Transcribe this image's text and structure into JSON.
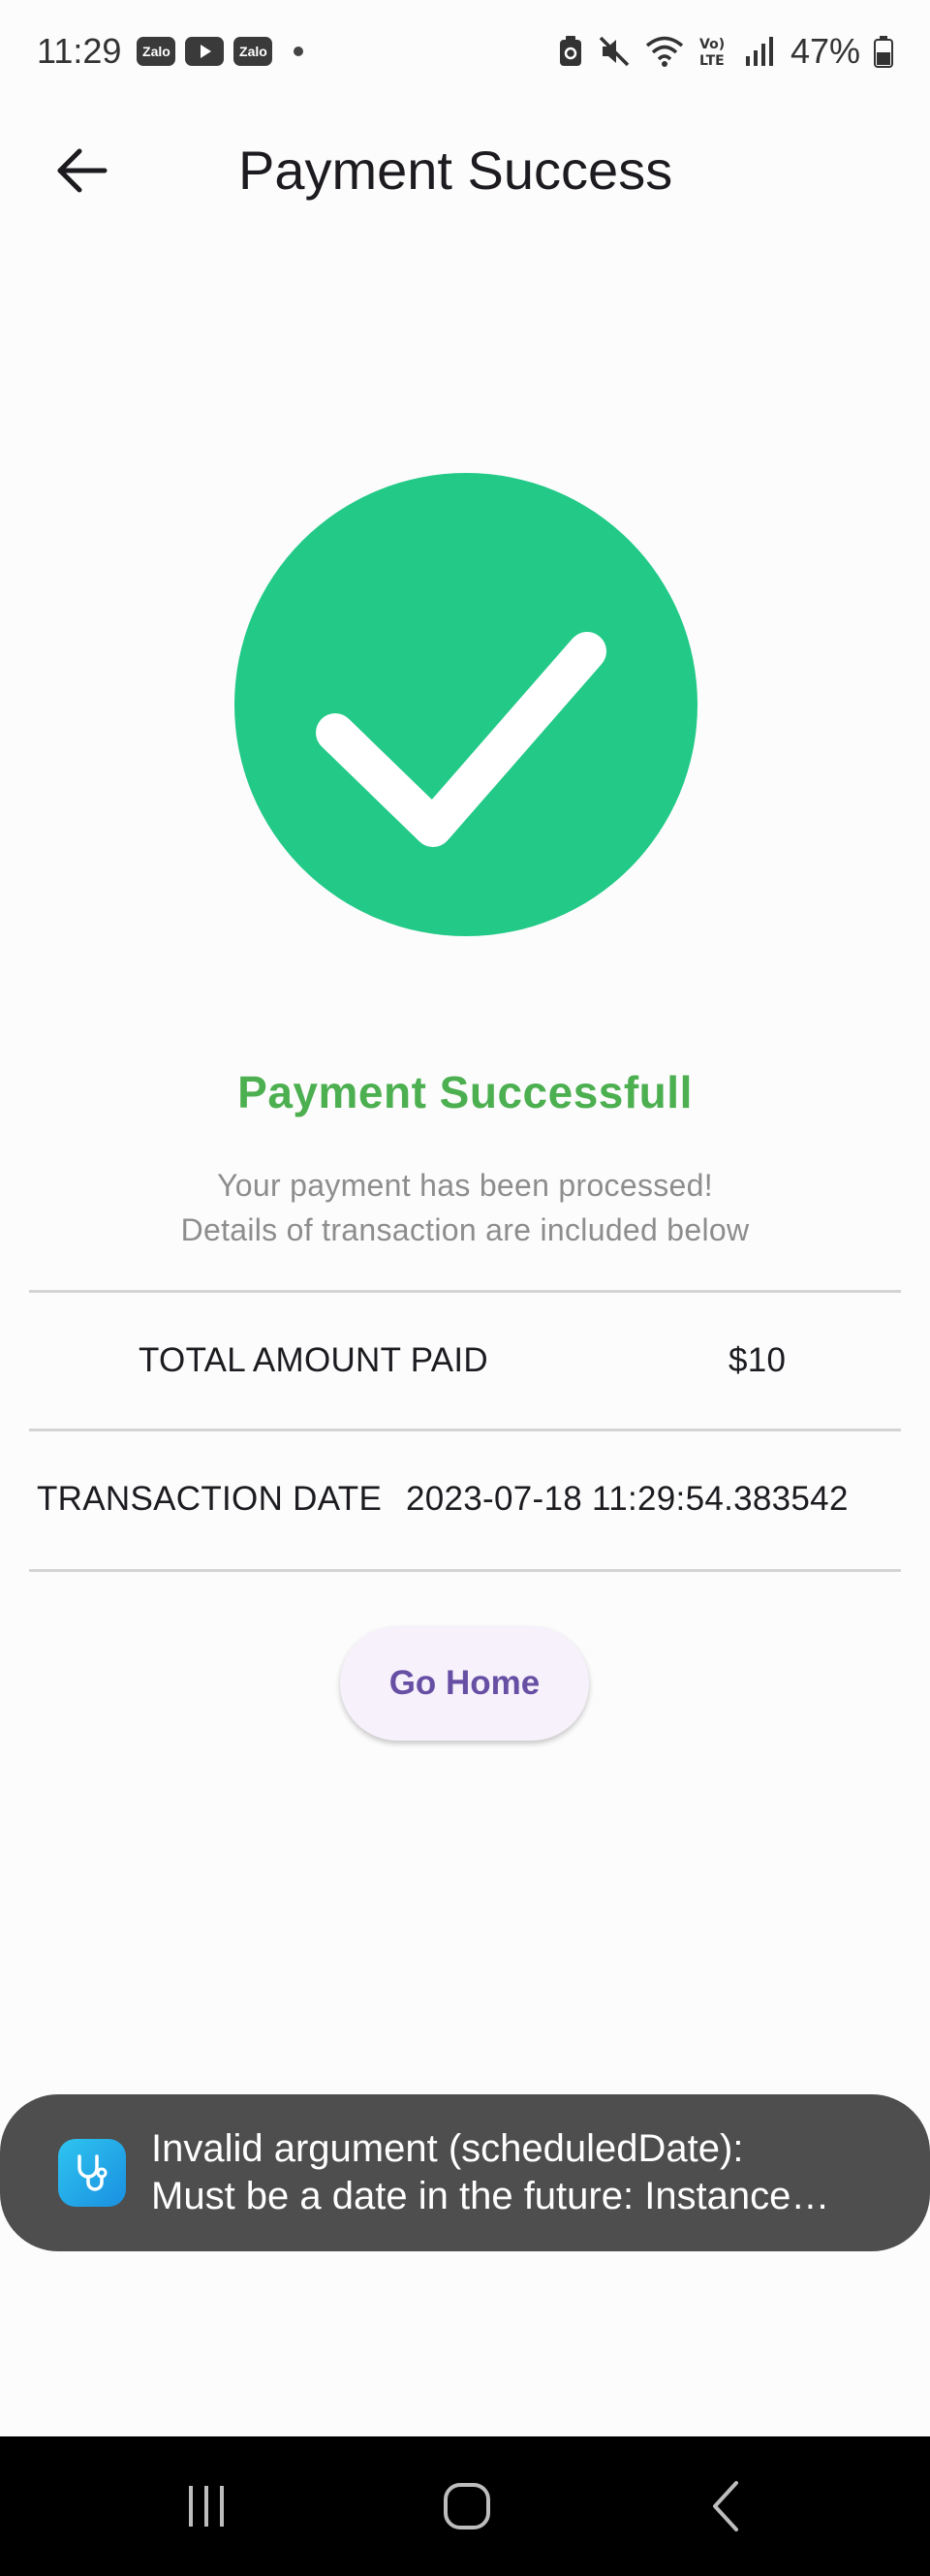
{
  "status_bar": {
    "time": "11:29",
    "notifications": [
      "Zalo",
      "YouTube",
      "Zalo"
    ],
    "signal_label": "Vo) LTE",
    "battery_percent": "47%"
  },
  "app_bar": {
    "title": "Payment Success",
    "back_icon": "arrow-left-icon"
  },
  "success": {
    "icon": "check-circle-icon",
    "icon_color": "#22c987",
    "heading": "Payment Successfull",
    "heading_color": "#4caf50",
    "line1": "Your payment has been processed!",
    "line2": "Details of transaction are included below"
  },
  "details": {
    "amount_label": "TOTAL AMOUNT PAID",
    "amount_value": "$10",
    "date_label": "TRANSACTION DATE",
    "date_value": "2023-07-18 11:29:54.383542"
  },
  "actions": {
    "go_home_label": "Go Home",
    "accent_color": "#6750a4"
  },
  "toast": {
    "app_icon": "stethoscope-icon",
    "line1": "Invalid argument (scheduledDate):",
    "line2": "Must be a date in the future: Instance…"
  },
  "nav_bar": {
    "recents_icon": "recents-icon",
    "home_icon": "home-icon",
    "back_icon": "back-chevron-icon"
  }
}
